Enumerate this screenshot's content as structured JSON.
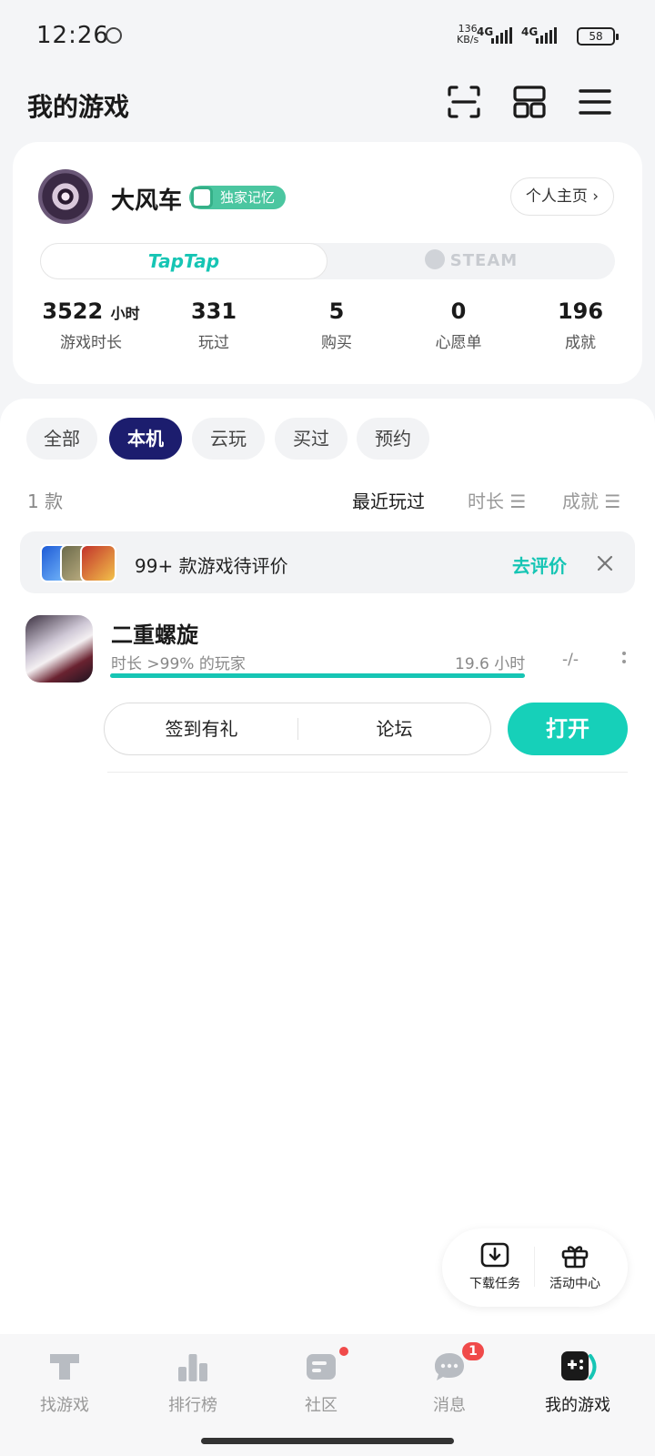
{
  "status_bar": {
    "time": "12:26",
    "net_speed_value": "136",
    "net_speed_unit": "KB/s",
    "signal1": "4G",
    "signal2": "4G",
    "battery": "58"
  },
  "header": {
    "title": "我的游戏",
    "icons": [
      "scan-icon",
      "grid-icon",
      "menu-icon"
    ]
  },
  "profile": {
    "username": "大风车",
    "badge": "独家记忆",
    "home_button": "个人主页 ›",
    "platforms": {
      "taptap": "TapTap",
      "steam": "STEAM",
      "active": "taptap"
    },
    "stats": [
      {
        "value": "3522",
        "unit": "小时",
        "label": "游戏时长"
      },
      {
        "value": "331",
        "unit": "",
        "label": "玩过"
      },
      {
        "value": "5",
        "unit": "",
        "label": "购买"
      },
      {
        "value": "0",
        "unit": "",
        "label": "心愿单"
      },
      {
        "value": "196",
        "unit": "",
        "label": "成就"
      }
    ]
  },
  "filters": [
    "全部",
    "本机",
    "云玩",
    "买过",
    "预约"
  ],
  "active_filter": "本机",
  "list_header": {
    "count": "1 款",
    "sort": [
      "最近玩过",
      "时长 ☰",
      "成就 ☰"
    ],
    "active_sort": "最近玩过"
  },
  "review_banner": {
    "text": "99+ 款游戏待评价",
    "action": "去评价"
  },
  "games": [
    {
      "title": "二重螺旋",
      "meta": "时长 >99% 的玩家",
      "hours": "19.6 小时",
      "progress": 1.0,
      "rating": "-/-",
      "actions": [
        "签到有礼",
        "论坛"
      ],
      "open_label": "打开"
    }
  ],
  "float_panel": {
    "download": "下载任务",
    "events": "活动中心"
  },
  "bottom_nav": [
    {
      "label": "找游戏",
      "icon": "taptap-icon"
    },
    {
      "label": "排行榜",
      "icon": "ranking-icon"
    },
    {
      "label": "社区",
      "icon": "community-icon"
    },
    {
      "label": "消息",
      "icon": "message-icon",
      "badge": "1"
    },
    {
      "label": "我的游戏",
      "icon": "gamepad-icon",
      "active": true
    }
  ],
  "colors": {
    "accent": "#16c5b4",
    "active_filter_bg": "#1c1d6e",
    "badge_red": "#f04a4a",
    "badge_green": "#4bc6a0"
  }
}
